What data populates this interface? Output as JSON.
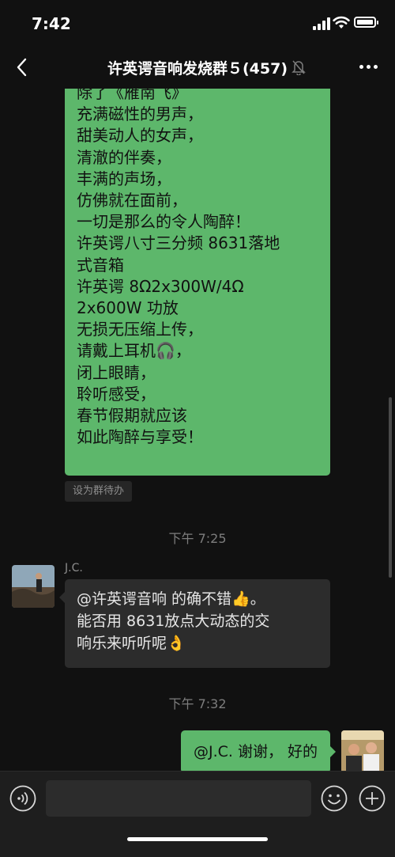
{
  "status_bar": {
    "time": "7:42"
  },
  "nav": {
    "title": "许英谔音响发烧群５(457)"
  },
  "messages": {
    "long_message_lines": [
      "除了《雁南飞》",
      "充满磁性的男声，",
      "甜美动人的女声，",
      "清澈的伴奏，",
      "丰满的声场，",
      "仿佛就在面前，",
      "一切是那么的令人陶醉！",
      "许英谔八寸三分频 8631落地",
      "式音箱",
      "许英谔 8Ω2x300W/4Ω",
      "2x600W 功放",
      "无损无压缩上传，",
      "请戴上耳机🎧，",
      "闭上眼睛，",
      "聆听感受，",
      "春节假期就应该",
      "如此陶醉与享受！"
    ],
    "todo_chip": "设为群待办",
    "timestamp_1": "下午 7:25",
    "sender_name": "J.C.",
    "reply_line_1": "@许英谔音响 的确不错👍。",
    "reply_line_2": "能否用 8631放点大动态的交",
    "reply_line_3": "响乐来听听呢👌",
    "timestamp_2": "下午 7:32",
    "self_reply": "@J.C. 谢谢，  好的"
  },
  "icons": {
    "back": "chevron-left-icon",
    "mute": "bell-slash-icon",
    "more": "more-dots-icon",
    "voice": "voice-input-icon",
    "emoji": "emoji-icon",
    "plus": "plus-icon"
  },
  "colors": {
    "background": "#111111",
    "bubble_self": "#5db76b",
    "bubble_other": "#2c2c2c",
    "input_bar": "#1e1e1e"
  }
}
